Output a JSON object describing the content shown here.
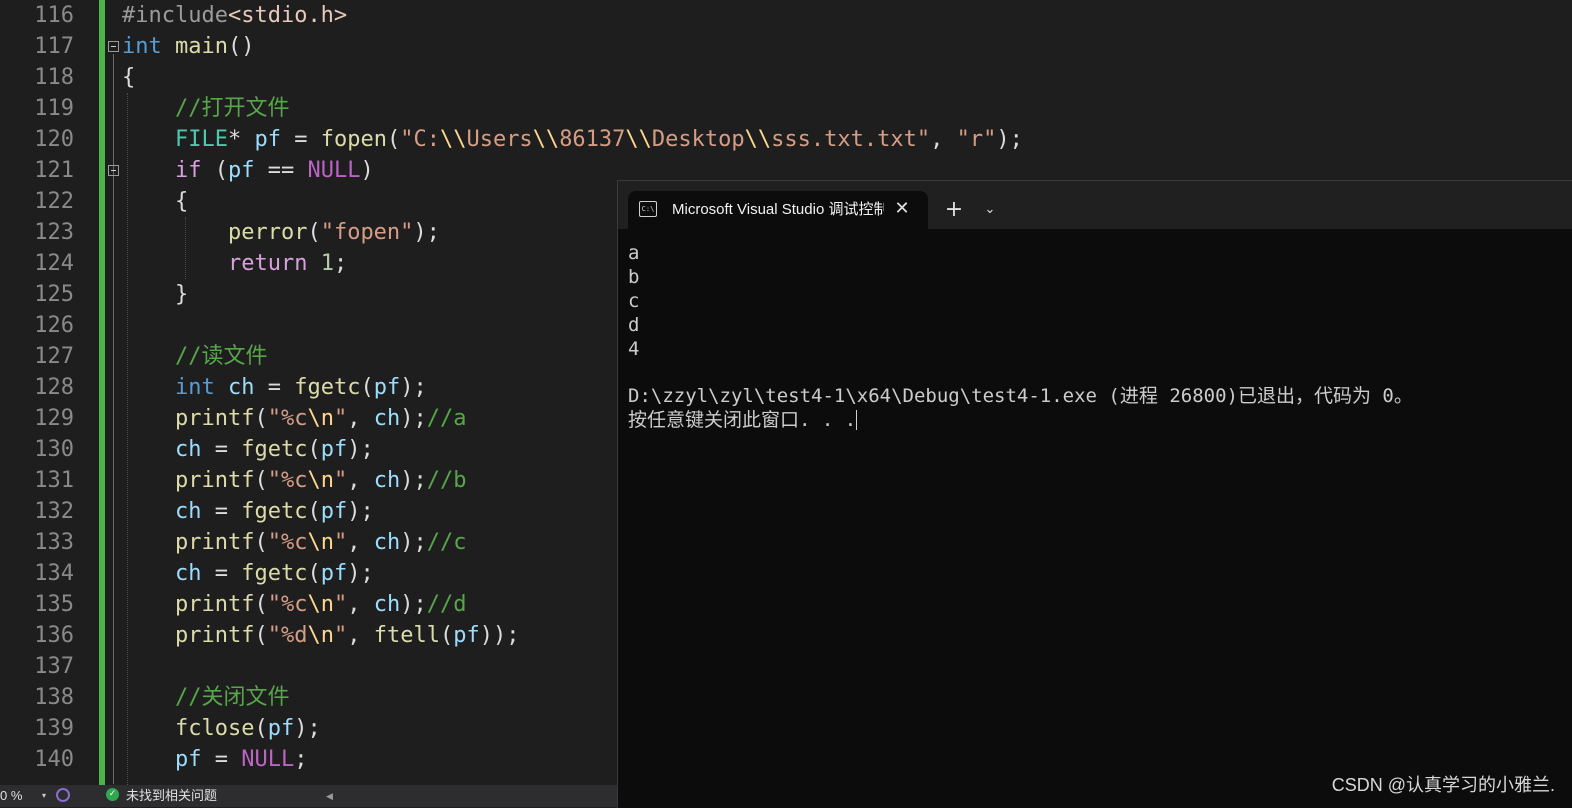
{
  "editor": {
    "line_numbers": [
      "116",
      "117",
      "118",
      "119",
      "120",
      "121",
      "122",
      "123",
      "124",
      "125",
      "126",
      "127",
      "128",
      "129",
      "130",
      "131",
      "132",
      "133",
      "134",
      "135",
      "136",
      "137",
      "138",
      "139",
      "140"
    ],
    "tokens": {
      "l116": [
        "#include",
        "<stdio.h>"
      ],
      "l117": [
        "int",
        " ",
        "main",
        "()"
      ],
      "l118": [
        "{"
      ],
      "l119": [
        "    ",
        "//打开文件"
      ],
      "l120": [
        "    ",
        "FILE",
        "* ",
        "pf",
        " = ",
        "fopen",
        "(",
        "\"C:",
        "\\\\",
        "Users",
        "\\\\",
        "86137",
        "\\\\",
        "Desktop",
        "\\\\",
        "sss.txt.txt\"",
        ", ",
        "\"r\"",
        ");"
      ],
      "l121": [
        "    ",
        "if",
        " (",
        "pf",
        " == ",
        "NULL",
        ")"
      ],
      "l122": [
        "    {"
      ],
      "l123": [
        "        ",
        "perror",
        "(",
        "\"fopen\"",
        ");"
      ],
      "l124": [
        "        ",
        "return",
        " ",
        "1",
        ";"
      ],
      "l125": [
        "    }"
      ],
      "l126": [
        ""
      ],
      "l127": [
        "    ",
        "//读文件"
      ],
      "l128": [
        "    ",
        "int",
        " ",
        "ch",
        " = ",
        "fgetc",
        "(",
        "pf",
        ");"
      ],
      "l129": [
        "    ",
        "printf",
        "(",
        "\"%c",
        "\\n",
        "\"",
        ", ",
        "ch",
        ");",
        "//a"
      ],
      "l130": [
        "    ",
        "ch",
        " = ",
        "fgetc",
        "(",
        "pf",
        ");"
      ],
      "l131": [
        "    ",
        "printf",
        "(",
        "\"%c",
        "\\n",
        "\"",
        ", ",
        "ch",
        ");",
        "//b"
      ],
      "l132": [
        "    ",
        "ch",
        " = ",
        "fgetc",
        "(",
        "pf",
        ");"
      ],
      "l133": [
        "    ",
        "printf",
        "(",
        "\"%c",
        "\\n",
        "\"",
        ", ",
        "ch",
        ");",
        "//c"
      ],
      "l134": [
        "    ",
        "ch",
        " = ",
        "fgetc",
        "(",
        "pf",
        ");"
      ],
      "l135": [
        "    ",
        "printf",
        "(",
        "\"%c",
        "\\n",
        "\"",
        ", ",
        "ch",
        ");",
        "//d"
      ],
      "l136": [
        "    ",
        "printf",
        "(",
        "\"%d",
        "\\n",
        "\"",
        ", ",
        "ftell",
        "(",
        "pf",
        "));"
      ],
      "l137": [
        ""
      ],
      "l138": [
        "    ",
        "//关闭文件"
      ],
      "l139": [
        "    ",
        "fclose",
        "(",
        "pf",
        ");"
      ],
      "l140": [
        "    ",
        "pf",
        " = ",
        "NULL",
        ";"
      ]
    }
  },
  "terminal": {
    "tab_title": "Microsoft Visual Studio 调试控制台",
    "tab_icon_text": "C:\\",
    "close_glyph": "✕",
    "new_tab_glyph": "+",
    "menu_glyph": "⌄",
    "output": [
      "a",
      "b",
      "c",
      "d",
      "4",
      "",
      "D:\\zzyl\\zyl\\test4-1\\x64\\Debug\\test4-1.exe (进程 26800)已退出，代码为 0。",
      "按任意键关闭此窗口. . ."
    ]
  },
  "watermark": "CSDN @认真学习的小雅兰.",
  "statusbar": {
    "zoom": "0 %",
    "zoom_arrow": "▾",
    "issues_icon": "✓",
    "issues_text": "未找到相关问题",
    "scroll_left": "◀"
  },
  "colors": {
    "editor_bg": "#1e1e1e",
    "change_bar": "#4ab54a",
    "terminal_bg": "#0c0c0c",
    "terminal_tabbar": "#202020",
    "comment": "#57a64a",
    "keyword": "#569cd6",
    "string": "#d69d85"
  },
  "icons": {
    "tab_icon": "console-icon",
    "close": "close-icon",
    "new_tab": "plus-icon",
    "dropdown": "chevron-down-icon",
    "health": "health-status-icon",
    "issues": "check-circle-icon"
  }
}
